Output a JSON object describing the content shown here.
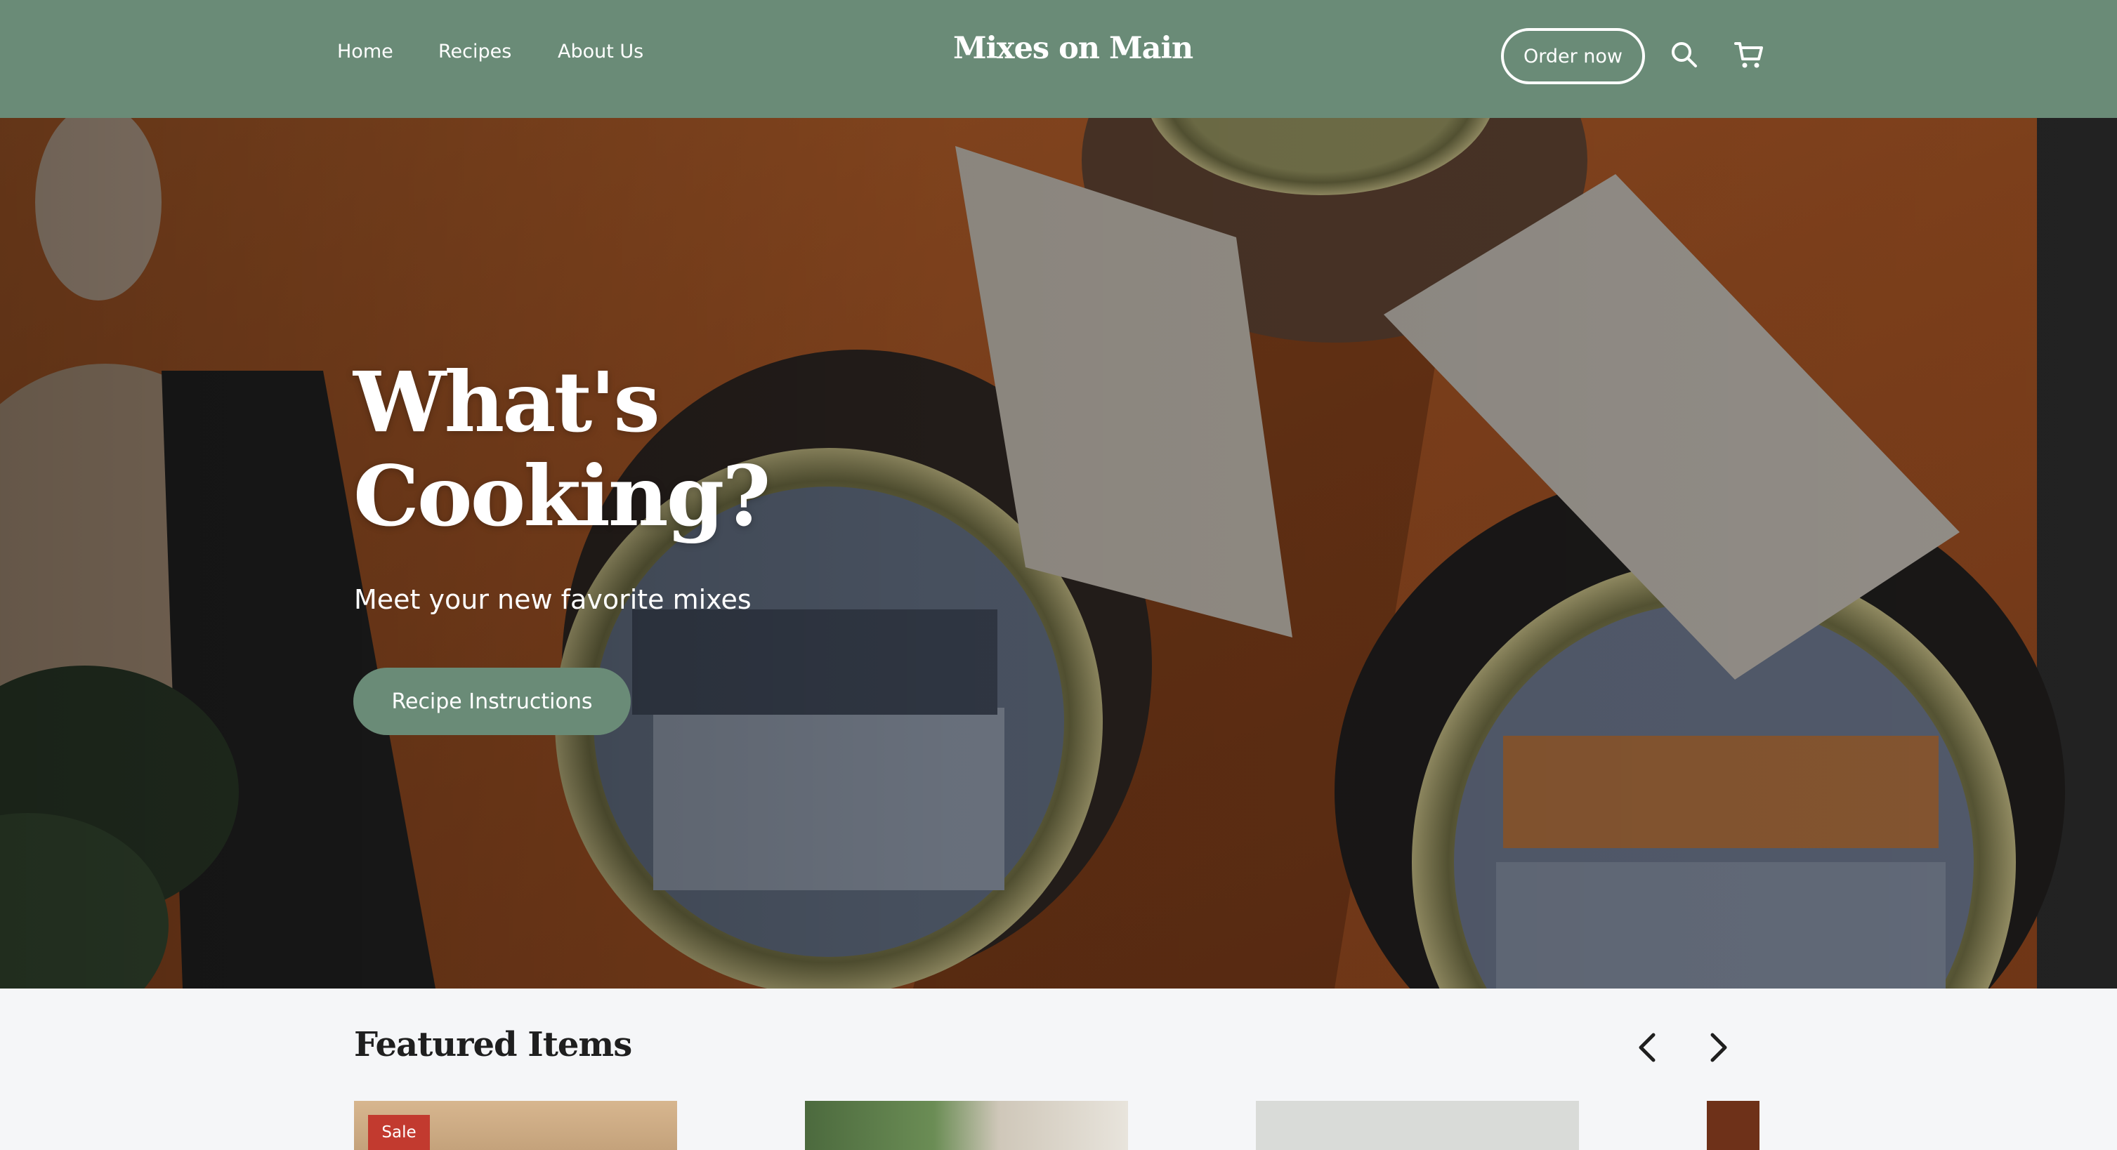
{
  "header": {
    "nav": [
      "Home",
      "Recipes",
      "About Us"
    ],
    "brand": "Mixes on Main",
    "order_label": "Order now",
    "icons": [
      "search-icon",
      "cart-icon"
    ]
  },
  "hero": {
    "title_line1": "What's",
    "title_line2": "Cooking?",
    "subtitle": "Meet your new favorite mixes",
    "button_label": "Recipe Instructions"
  },
  "featured": {
    "title": "Featured Items",
    "prev_icon": "chevron-left-icon",
    "next_icon": "chevron-right-icon",
    "cards": [
      {
        "badge": "Sale"
      },
      {
        "badge": ""
      },
      {
        "badge": ""
      },
      {
        "badge": ""
      }
    ]
  },
  "colors": {
    "header_bg": "#6a8b77",
    "button_bg": "#6a8b77",
    "sale_badge": "#c23a2f",
    "page_bg": "#f5f6f8"
  }
}
